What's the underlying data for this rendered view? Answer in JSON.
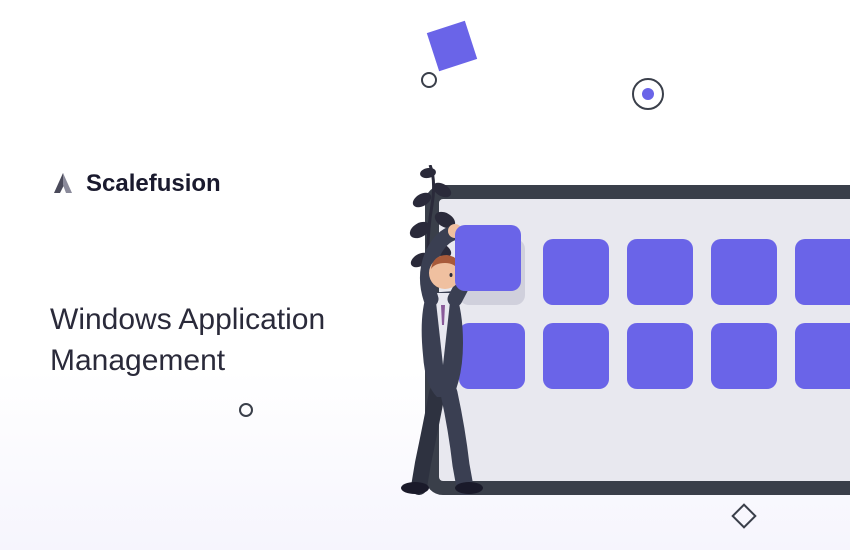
{
  "brand": {
    "name": "Scalefusion"
  },
  "headline": {
    "line1": "Windows Application",
    "line2": "Management"
  },
  "colors": {
    "accent": "#6a64e8",
    "frame": "#3a3f4a",
    "tile_placeholder": "#d0d0dc",
    "tablet_bg": "#e8e8ef"
  }
}
